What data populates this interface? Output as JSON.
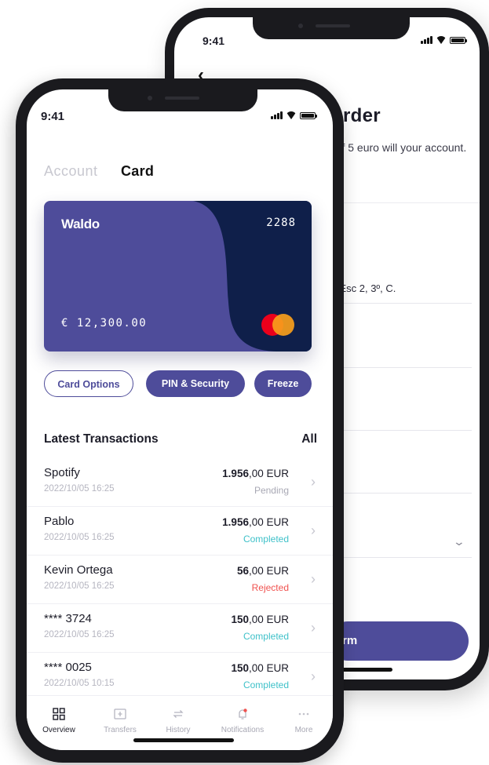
{
  "back_screen": {
    "status_time": "9:41",
    "back_icon": "chevron-left-icon",
    "title": "Order",
    "description": "e of 5 euro will your account.",
    "address": "7, Esc 2, 3º, C.",
    "confirm_label": "rm",
    "dropdown_icon": "chevron-down-icon"
  },
  "front_screen": {
    "status_time": "9:41",
    "tabs": {
      "account": "Account",
      "card": "Card"
    },
    "card": {
      "brand": "Waldo",
      "last4": "2288",
      "balance": "€ 12,300.00",
      "network_icon": "mastercard-logo",
      "colors": {
        "primary": "#4e4c9a",
        "dark": "#0f1f4a"
      }
    },
    "actions": {
      "card_options": "Card Options",
      "pin_security": "PIN & Security",
      "freeze": "Freeze"
    },
    "transactions_header": {
      "title": "Latest Transactions",
      "all": "All"
    },
    "transactions": [
      {
        "name": "Spotify",
        "date": "2022/10/05 16:25",
        "amount_int": "1.956",
        "amount_rest": ",00 EUR",
        "status": "Pending",
        "status_color": "#a8a8b4"
      },
      {
        "name": "Pablo",
        "date": "2022/10/05 16:25",
        "amount_int": "1.956",
        "amount_rest": ",00 EUR",
        "status": "Completed",
        "status_color": "#3fc1c9"
      },
      {
        "name": "Kevin Ortega",
        "date": "2022/10/05 16:25",
        "amount_int": "56",
        "amount_rest": ",00 EUR",
        "status": "Rejected",
        "status_color": "#f0524f"
      },
      {
        "name": "**** 3724",
        "date": "2022/10/05 16:25",
        "amount_int": "150",
        "amount_rest": ",00 EUR",
        "status": "Completed",
        "status_color": "#3fc1c9"
      },
      {
        "name": "**** 0025",
        "date": "2022/10/05 10:15",
        "amount_int": "150",
        "amount_rest": ",00 EUR",
        "status": "Completed",
        "status_color": "#3fc1c9"
      }
    ],
    "nav": [
      {
        "label": "Overview",
        "icon": "grid-icon",
        "active": true
      },
      {
        "label": "Transfers",
        "icon": "transfer-icon",
        "active": false
      },
      {
        "label": "History",
        "icon": "history-icon",
        "active": false
      },
      {
        "label": "Notifications",
        "icon": "bell-icon",
        "active": false
      },
      {
        "label": "More",
        "icon": "more-dots-icon",
        "active": false
      }
    ]
  }
}
